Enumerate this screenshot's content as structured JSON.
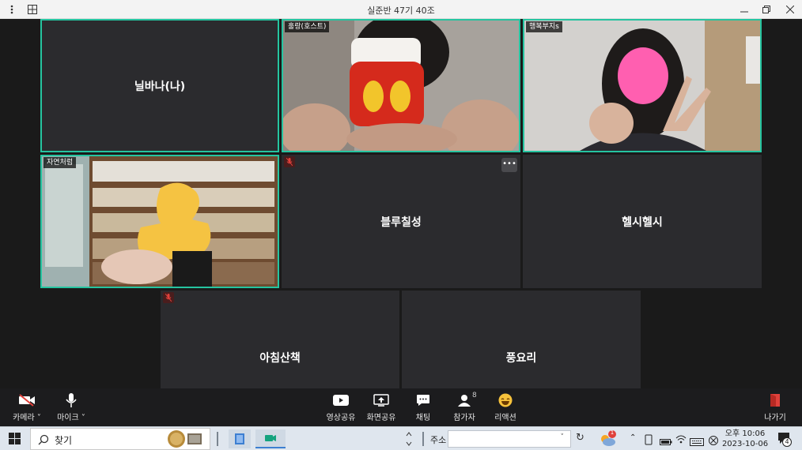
{
  "window": {
    "title": "실준반 47기 40조"
  },
  "participants": [
    {
      "name": "닐바나(나)",
      "video": false,
      "active": true,
      "muted": false
    },
    {
      "name": "훌랑(호스트)",
      "video": true,
      "active": true,
      "muted": false
    },
    {
      "name": "행복부지s",
      "video": true,
      "active": true,
      "muted": false
    },
    {
      "name": "자연처럼",
      "video": true,
      "active": true,
      "muted": false
    },
    {
      "name": "블루칠성",
      "video": false,
      "active": false,
      "muted": true
    },
    {
      "name": "헬시헬시",
      "video": false,
      "active": false,
      "muted": false
    },
    {
      "name": "아침산책",
      "video": false,
      "active": false,
      "muted": true
    },
    {
      "name": "풍요리",
      "video": false,
      "active": false,
      "muted": false
    }
  ],
  "toolbar": {
    "camera_label": "카메라",
    "mic_label": "마이크",
    "share_video_label": "영상공유",
    "share_screen_label": "화면공유",
    "chat_label": "채팅",
    "participants_label": "참가자",
    "participants_count": "8",
    "reaction_label": "리액션",
    "leave_label": "나가기"
  },
  "taskbar": {
    "search_placeholder": "찾기",
    "address_label": "주소",
    "weather_badge": "1",
    "time": "오후 10:06",
    "date": "2023-10-06",
    "notification_count": "4"
  },
  "colors": {
    "active_border": "#25c4a0",
    "leave_red": "#e0413b",
    "tile_bg": "#2b2b2e"
  }
}
